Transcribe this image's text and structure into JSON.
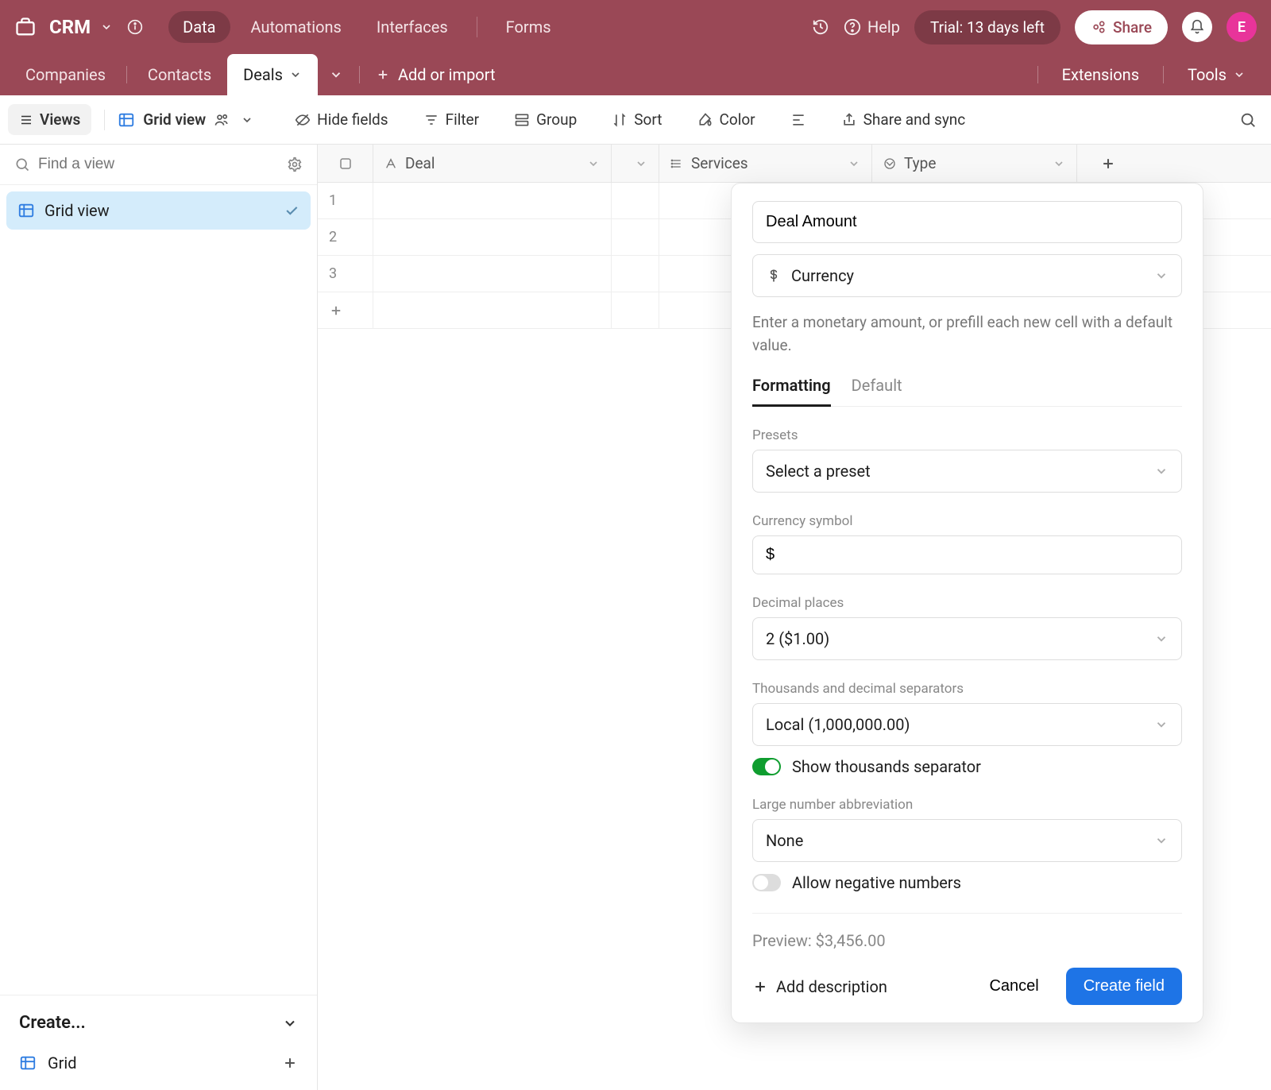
{
  "topbar": {
    "app_name": "CRM",
    "nav": {
      "data": "Data",
      "automations": "Automations",
      "interfaces": "Interfaces",
      "forms": "Forms"
    },
    "help": "Help",
    "trial": "Trial: 13 days left",
    "share": "Share",
    "avatar_initial": "E"
  },
  "tabbar": {
    "tabs": {
      "companies": "Companies",
      "contacts": "Contacts",
      "deals": "Deals"
    },
    "add_or_import": "Add or import",
    "extensions": "Extensions",
    "tools": "Tools"
  },
  "toolbar": {
    "views": "Views",
    "grid_view": "Grid view",
    "hide_fields": "Hide fields",
    "filter": "Filter",
    "group": "Group",
    "sort": "Sort",
    "color": "Color",
    "share_sync": "Share and sync"
  },
  "sidebar": {
    "find_placeholder": "Find a view",
    "view_item": "Grid view",
    "create_label": "Create...",
    "grid_label": "Grid"
  },
  "grid": {
    "columns": {
      "deal": "Deal",
      "services": "Services",
      "type": "Type"
    },
    "rows": [
      "1",
      "2",
      "3"
    ]
  },
  "popover": {
    "name_value": "Deal Amount",
    "type_value": "Currency",
    "description": "Enter a monetary amount, or prefill each new cell with a default value.",
    "tabs": {
      "formatting": "Formatting",
      "default": "Default"
    },
    "presets_label": "Presets",
    "presets_value": "Select a preset",
    "symbol_label": "Currency symbol",
    "symbol_value": "$",
    "decimal_label": "Decimal places",
    "decimal_value": "2 ($1.00)",
    "separators_label": "Thousands and decimal separators",
    "separators_value": "Local (1,000,000.00)",
    "show_thousands": "Show thousands separator",
    "abbrev_label": "Large number abbreviation",
    "abbrev_value": "None",
    "allow_negative": "Allow negative numbers",
    "preview": "Preview: $3,456.00",
    "add_description": "Add description",
    "cancel": "Cancel",
    "create": "Create field"
  }
}
